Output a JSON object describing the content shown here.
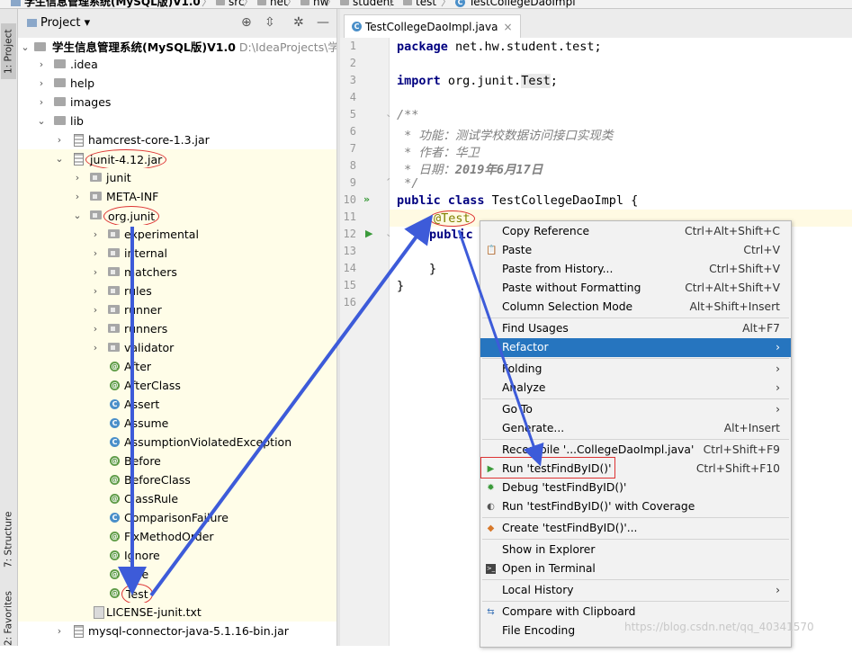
{
  "breadcrumb": [
    {
      "label": "学生信息管理系统(MySQL版)V1.0",
      "icon": "project-icon"
    },
    {
      "label": "src",
      "icon": "folder-icon"
    },
    {
      "label": "net",
      "icon": "folder-icon"
    },
    {
      "label": "hw",
      "icon": "folder-icon"
    },
    {
      "label": "student",
      "icon": "folder-icon"
    },
    {
      "label": "test",
      "icon": "folder-icon"
    },
    {
      "label": "TestCollegeDaoImpl",
      "icon": "class-icon"
    }
  ],
  "left_strip": {
    "project": "1: Project",
    "structure": "7: Structure",
    "favorites": "2: Favorites"
  },
  "project_panel": {
    "title": "Project ▾"
  },
  "tree": {
    "root_name": "学生信息管理系统(MySQL版)V1.0",
    "root_path": "D:\\IdeaProjects\\学生信",
    "idea": ".idea",
    "help": "help",
    "images": "images",
    "lib": "lib",
    "hamcrest": "hamcrest-core-1.3.jar",
    "junit_jar": "junit-4.12.jar",
    "junit_pkg": "junit",
    "meta_inf": "META-INF",
    "org_junit": "org.junit",
    "experimental": "experimental",
    "internal": "internal",
    "matchers": "matchers",
    "rules": "rules",
    "runner": "runner",
    "runners": "runners",
    "validator": "validator",
    "after": "After",
    "afterclass": "AfterClass",
    "assert": "Assert",
    "assume": "Assume",
    "assumption": "AssumptionViolatedException",
    "before": "Before",
    "beforeclass": "BeforeClass",
    "classrule": "ClassRule",
    "comparison": "ComparisonFailure",
    "fixmethod": "FixMethodOrder",
    "ignore": "Ignore",
    "rule": "Rule",
    "test": "Test",
    "license": "LICENSE-junit.txt",
    "mysql": "mysql-connector-java-5.1.16-bin.jar"
  },
  "editor": {
    "tab_label": "TestCollegeDaoImpl.java",
    "tab_close": "×",
    "line_numbers": [
      "1",
      "2",
      "3",
      "4",
      "5",
      "6",
      "7",
      "8",
      "9",
      "10",
      "11",
      "12",
      "13",
      "14",
      "15",
      "16"
    ],
    "l1_kw": "package",
    "l1_rest": " net.hw.student.test;",
    "l3_kw": "import",
    "l3_mid": " org.junit.",
    "l3_test": "Test",
    "l3_end": ";",
    "l5": "/**",
    "l6": " * 功能：测试学校数据访问接口实现类",
    "l7": " * 作者：华卫",
    "l8a": " * 日期：",
    "l8b": "2019年6月17日",
    "l9": " */",
    "l10_kw": "public class",
    "l10_rest": " TestCollegeDaoImpl {",
    "l11": "@Test",
    "l12": "public",
    "l14": "}",
    "l15": "}"
  },
  "context_menu": {
    "copy_ref": {
      "label": "Copy Reference",
      "shortcut": "Ctrl+Alt+Shift+C"
    },
    "paste": {
      "label": "Paste",
      "shortcut": "Ctrl+V"
    },
    "paste_history": {
      "label": "Paste from History...",
      "shortcut": "Ctrl+Shift+V"
    },
    "paste_no_fmt": {
      "label": "Paste without Formatting",
      "shortcut": "Ctrl+Alt+Shift+V"
    },
    "column_mode": {
      "label": "Column Selection Mode",
      "shortcut": "Alt+Shift+Insert"
    },
    "find_usages": {
      "label": "Find Usages",
      "shortcut": "Alt+F7"
    },
    "refactor": {
      "label": "Refactor",
      "arrow": "›"
    },
    "folding": {
      "label": "Folding",
      "arrow": "›"
    },
    "analyze": {
      "label": "Analyze",
      "arrow": "›"
    },
    "goto": {
      "label": "Go To",
      "arrow": "›"
    },
    "generate": {
      "label": "Generate...",
      "shortcut": "Alt+Insert"
    },
    "recompile": {
      "label": "Recompile '...CollegeDaoImpl.java'",
      "shortcut": "Ctrl+Shift+F9"
    },
    "run": {
      "label": "Run 'testFindByID()'",
      "shortcut": "Ctrl+Shift+F10"
    },
    "debug": {
      "label": "Debug 'testFindByID()'"
    },
    "coverage": {
      "label": "Run 'testFindByID()' with Coverage"
    },
    "create": {
      "label": "Create 'testFindByID()'..."
    },
    "explorer": {
      "label": "Show in Explorer"
    },
    "terminal": {
      "label": "Open in Terminal"
    },
    "local_history": {
      "label": "Local History",
      "arrow": "›"
    },
    "compare": {
      "label": "Compare with Clipboard"
    },
    "encoding": {
      "label": "File Encoding"
    }
  },
  "watermark": "https://blog.csdn.net/qq_40341570",
  "colors": {
    "selection": "#2675bf",
    "annotation_red": "#dd3333",
    "arrow_blue": "#3d5bd9"
  }
}
